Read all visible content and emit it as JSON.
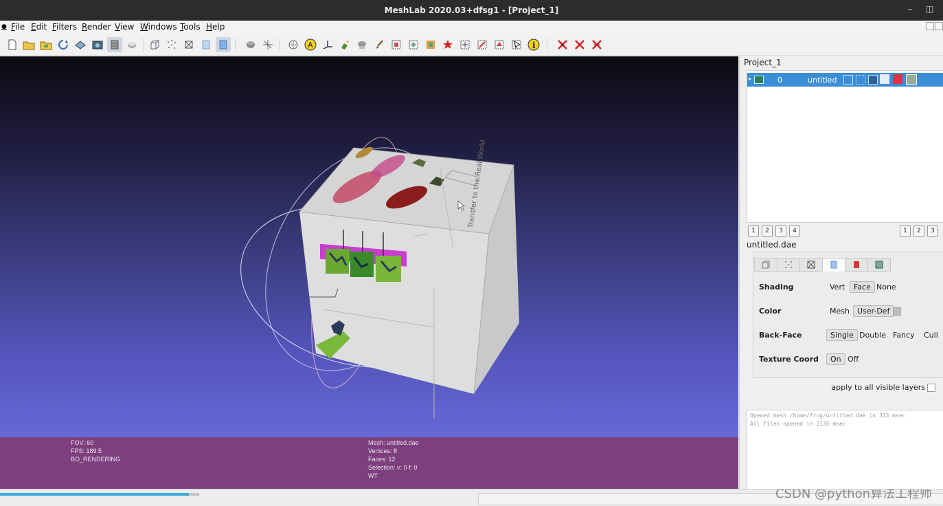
{
  "window": {
    "title": "MeshLab 2020.03+dfsg1 - [Project_1]",
    "minimize": "–",
    "restore": "◫"
  },
  "menu": [
    "File",
    "Edit",
    "Filters",
    "Render",
    "View",
    "Windows",
    "Tools",
    "Help"
  ],
  "toolbar": {
    "icons": [
      "new-project-icon",
      "open-project-icon",
      "import-mesh-icon",
      "reload-icon",
      "export-mesh-icon",
      "snapshot-icon",
      "layers-icon",
      "raster-icon",
      "bounding-box-icon",
      "points-icon",
      "wireframe-icon",
      "flat-icon",
      "smooth-icon",
      "light-icon",
      "trackball-icon",
      "info-pane-icon",
      "annotation-icon",
      "axis-icon",
      "paint-icon",
      "select-vertex-icon",
      "brush-icon",
      "select-faces-icon",
      "select-connected-icon",
      "quality-icon",
      "georef-icon",
      "manipulator-icon",
      "align-icon",
      "measure-icon",
      "pick-points-icon",
      "info-icon",
      "delete-vertices-icon",
      "delete-faces-icon",
      "delete-selection-icon"
    ]
  },
  "viewport": {
    "face_text": "Transfer to the Real World",
    "info_left": [
      "FOV: 60",
      "FPS:   189.5",
      "BO_RENDERING"
    ],
    "info_right": [
      "Mesh: untitled.dae",
      "Vertices: 8",
      "Faces: 12",
      "Selection: v: 0 f: 0",
      "WT"
    ]
  },
  "layers": {
    "project": "Project_1",
    "row": {
      "index": "0",
      "name": "untitled"
    },
    "left_buttons": [
      "1",
      "2",
      "3",
      "4"
    ],
    "right_buttons": [
      "1",
      "2",
      "3"
    ]
  },
  "render_panel": {
    "file": "untitled.dae",
    "shading": {
      "label": "Shading",
      "options": [
        "Vert",
        "Face",
        "None"
      ],
      "selected": "Face"
    },
    "color": {
      "label": "Color",
      "options": [
        "Mesh",
        "User-Def"
      ],
      "selected": "User-Def"
    },
    "backface": {
      "label": "Back-Face",
      "options": [
        "Single",
        "Double",
        "Fancy",
        "Cull"
      ],
      "selected": "Single"
    },
    "texcoord": {
      "label": "Texture Coord",
      "options": [
        "On",
        "Off"
      ],
      "selected": "On"
    },
    "apply_all": "apply to all visible layers"
  },
  "log": [
    "Opened mesh /home/frog/untitled.dae in 313 msec",
    "All files opened in 2135 msec"
  ],
  "progress": {
    "fraction": 0.2
  },
  "watermark": "CSDN @python算法工程师"
}
